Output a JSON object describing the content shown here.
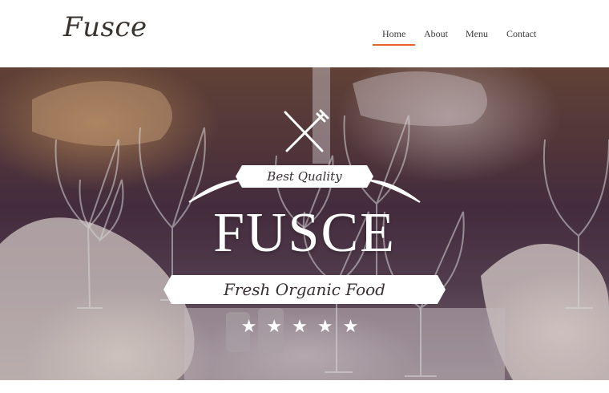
{
  "header": {
    "logo": "Fusce",
    "nav": [
      {
        "label": "Home",
        "active": true
      },
      {
        "label": "About",
        "active": false
      },
      {
        "label": "Menu",
        "active": false
      },
      {
        "label": "Contact",
        "active": false
      }
    ]
  },
  "hero": {
    "tagline": "Best Quality",
    "title": "FUSCE",
    "subtitle": "Fresh Organic Food",
    "stars": "★★★★★",
    "icon": "fork-knife-icon",
    "accent_color": "#e8642c"
  }
}
